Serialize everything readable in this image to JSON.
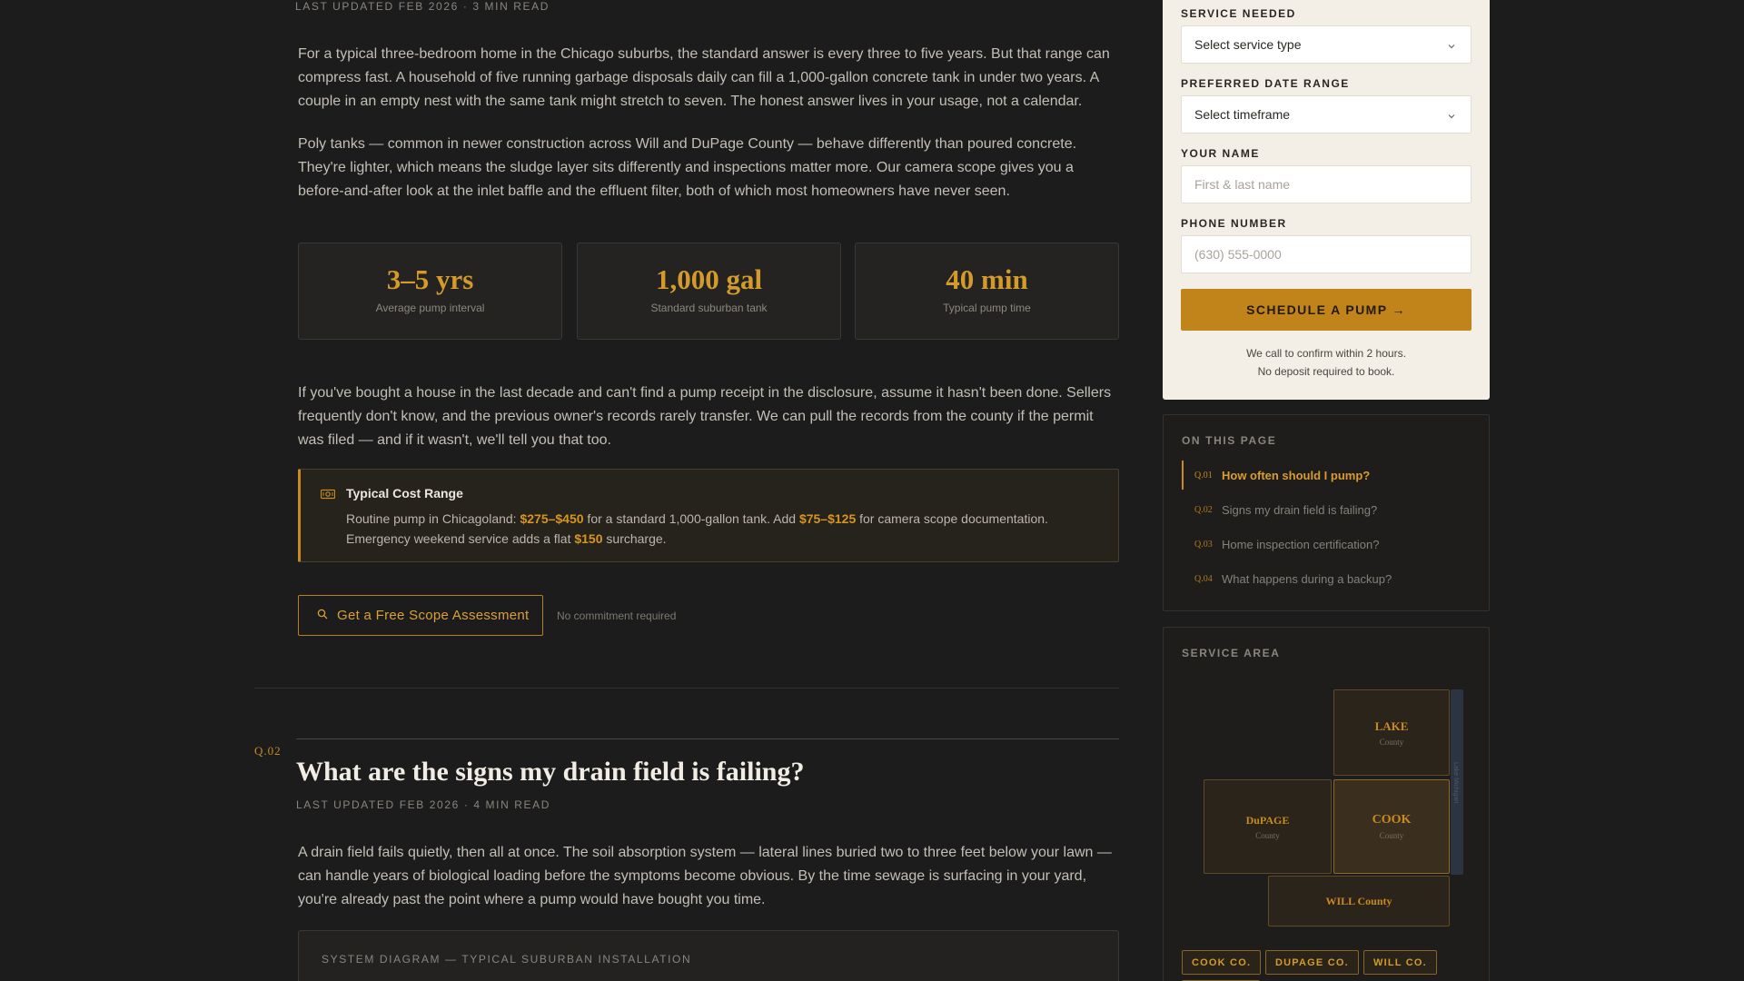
{
  "q1": {
    "meta": "LAST UPDATED FEB 2026 · 3 MIN READ",
    "para1": "For a typical three-bedroom home in the Chicago suburbs, the standard answer is every three to five years. But that range can compress fast. A household of five running garbage disposals daily can fill a 1,000-gallon concrete tank in under two years. A couple in an empty nest with the same tank might stretch to seven. The honest answer lives in your usage, not a calendar.",
    "para2": "Poly tanks — common in newer construction across Will and DuPage County — behave differently than poured concrete. They're lighter, which means the sludge layer sits differently and inspections matter more. Our camera scope gives you a before-and-after look at the inlet baffle and the effluent filter, both of which most homeowners have never seen.",
    "stats": [
      {
        "value": "3–5 yrs",
        "label": "Average pump interval"
      },
      {
        "value": "1,000 gal",
        "label": "Standard suburban tank"
      },
      {
        "value": "40 min",
        "label": "Typical pump time"
      }
    ],
    "para3": "If you've bought a house in the last decade and can't find a pump receipt in the disclosure, assume it hasn't been done. Sellers frequently don't know, and the previous owner's records rarely transfer. We can pull the records from the county if the permit was filed — and if it wasn't, we'll tell you that too.",
    "callout": {
      "title": "Typical Cost Range",
      "t1": "Routine pump in Chicagoland: ",
      "h1": "$275–$450",
      "t2": " for a standard 1,000-gallon tank. Add ",
      "h2": "$75–$125",
      "t3": " for camera scope documentation. Emergency weekend service adds a flat ",
      "h3": "$150",
      "t4": " surcharge."
    },
    "cta_label": "Get a Free Scope Assessment",
    "cta_note": "No commitment required"
  },
  "q2": {
    "num": "Q.02",
    "title": "What are the signs my drain field is failing?",
    "meta": "LAST UPDATED FEB 2026 · 4 MIN READ",
    "para1": "A drain field fails quietly, then all at once. The soil absorption system — lateral lines buried two to three feet below your lawn — can handle years of biological loading before the symptoms become obvious. By the time sewage is surfacing in your yard, you're already past the point where a pump would have bought you time.",
    "diagram_title": "SYSTEM DIAGRAM — TYPICAL SUBURBAN INSTALLATION"
  },
  "form": {
    "service_label": "SERVICE NEEDED",
    "service_value": "Select service type",
    "date_label": "PREFERRED DATE RANGE",
    "date_value": "Select timeframe",
    "name_label": "YOUR NAME",
    "name_placeholder": "First & last name",
    "phone_label": "PHONE NUMBER",
    "phone_placeholder": "(630) 555-0000",
    "submit": "SCHEDULE A PUMP →",
    "note1": "We call to confirm within 2 hours.",
    "note2": "No deposit required to book."
  },
  "toc": {
    "title": "ON THIS PAGE",
    "items": [
      {
        "num": "Q.01",
        "label": "How often should I pump?",
        "active": true
      },
      {
        "num": "Q.02",
        "label": "Signs my drain field is failing?",
        "active": false
      },
      {
        "num": "Q.03",
        "label": "Home inspection certification?",
        "active": false
      },
      {
        "num": "Q.04",
        "label": "What happens during a backup?",
        "active": false
      }
    ]
  },
  "service_area": {
    "title": "SERVICE AREA",
    "counties": {
      "lake": {
        "name": "LAKE",
        "sub": "County"
      },
      "dupage": {
        "name": "DuPAGE",
        "sub": "County"
      },
      "cook": {
        "name": "COOK",
        "sub": "County"
      },
      "will": {
        "name": "WILL County"
      }
    },
    "lake_michigan": "Lake Michigan",
    "tags": [
      "COOK CO.",
      "DUPAGE CO.",
      "WILL CO."
    ]
  },
  "colors": {
    "accent": "#c98a1f",
    "bg": "#1c1c1c",
    "form_bg": "#f3efe7"
  }
}
